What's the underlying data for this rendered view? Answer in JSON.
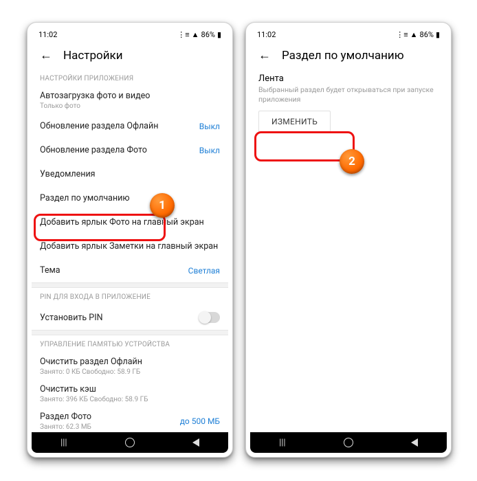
{
  "status": {
    "time": "11:02",
    "battery": "86%"
  },
  "left": {
    "title": "Настройки",
    "sect_app": "НАСТРОЙКИ ПРИЛОЖЕНИЯ",
    "rows": {
      "autoload": "Автозагрузка фото и видео",
      "autoload_sub": "Только фото",
      "offline": "Обновление раздела Офлайн",
      "offline_val": "Выкл",
      "photo": "Обновление раздела Фото",
      "photo_val": "Выкл",
      "notif": "Уведомления",
      "default": "Раздел по умолчанию",
      "shortcut_photo": "Добавить ярлык Фото на главный экран",
      "shortcut_notes": "Добавить ярлык Заметки на главный экран",
      "theme": "Тема",
      "theme_val": "Светлая"
    },
    "sect_pin": "PIN ДЛЯ ВХОДА В ПРИЛОЖЕНИЕ",
    "pin": "Установить PIN",
    "sect_mem": "УПРАВЛЕНИЕ ПАМЯТЬЮ УСТРОЙСТВА",
    "mem": {
      "clear_offline": "Очистить раздел Офлайн",
      "clear_offline_sub": "Занято: 0 КБ Свободно: 58.9 ГБ",
      "clear_cache": "Очистить кэш",
      "clear_cache_sub": "Занято: 396 КБ Свободно: 58.9 ГБ",
      "photo_section": "Раздел Фото",
      "photo_section_sub": "Занято: 62.3 МБ",
      "photo_section_val": "до 500 МБ"
    }
  },
  "right": {
    "title": "Раздел по умолчанию",
    "feed": "Лента",
    "desc": "Выбранный раздел будет открываться при запуске приложения",
    "change": "ИЗМЕНИТЬ"
  },
  "markers": {
    "m1": "1",
    "m2": "2"
  }
}
